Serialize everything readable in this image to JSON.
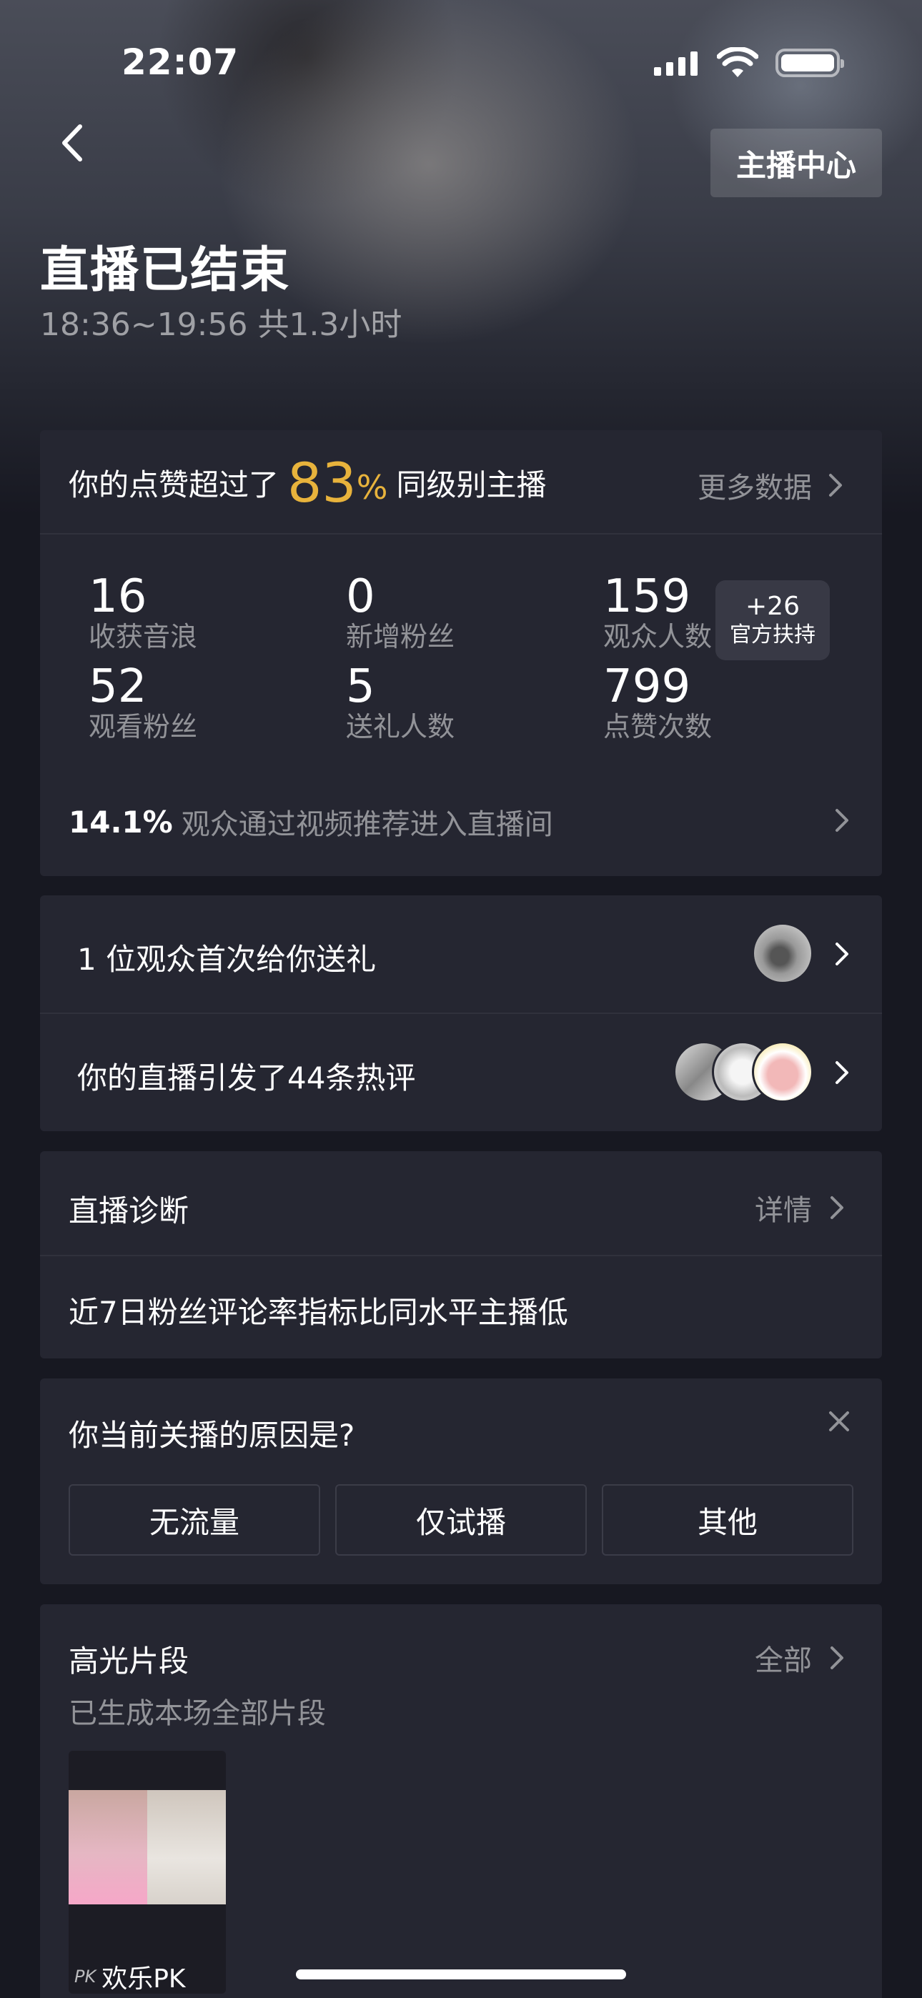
{
  "status_bar": {
    "time": "22:07"
  },
  "header": {
    "anchor_center_label": "主播中心",
    "title": "直播已结束",
    "subtitle": "18:36~19:56 共1.3小时"
  },
  "summary": {
    "like_prefix": "你的点赞超过了",
    "like_percent": "83",
    "like_percent_unit": "%",
    "like_suffix": "同级别主播",
    "more_data": "更多数据",
    "stats": [
      {
        "value": "16",
        "label": "收获音浪"
      },
      {
        "value": "0",
        "label": "新增粉丝"
      },
      {
        "value": "159",
        "label": "观众人数"
      },
      {
        "value": "52",
        "label": "观看粉丝"
      },
      {
        "value": "5",
        "label": "送礼人数"
      },
      {
        "value": "799",
        "label": "点赞次数"
      }
    ],
    "boost": {
      "value": "+26",
      "label": "官方扶持"
    },
    "recommend_percent": "14.1%",
    "recommend_text": "观众通过视频推荐进入直播间"
  },
  "highlights": {
    "gift_row": "1 位观众首次给你送礼",
    "comment_row": "你的直播引发了44条热评"
  },
  "diagnosis": {
    "title": "直播诊断",
    "detail": "详情",
    "message": "近7日粉丝评论率指标比同水平主播低"
  },
  "survey": {
    "question": "你当前关播的原因是?",
    "options": [
      "无流量",
      "仅试播",
      "其他"
    ]
  },
  "clips": {
    "title": "高光片段",
    "all": "全部",
    "subtitle": "已生成本场全部片段",
    "items": [
      {
        "badge": "PK",
        "label": "欢乐PK"
      }
    ]
  },
  "colors": {
    "accent": "#e8b33c",
    "card": "#252631",
    "background": "#171821"
  }
}
